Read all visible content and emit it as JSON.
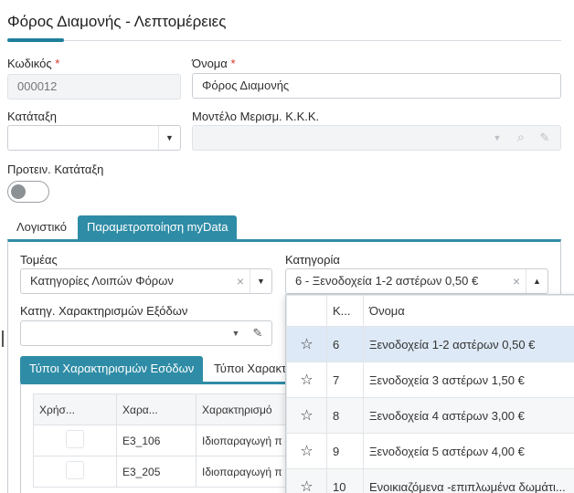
{
  "page": {
    "title": "Φόρος Διαμονής - Λεπτομέρειες"
  },
  "form": {
    "code_label": "Κωδικός",
    "code_value": "000012",
    "name_label": "Όνομα",
    "name_value": "Φόρος Διαμονής",
    "required_mark": "*",
    "category_label": "Κατάταξη",
    "category_value": "",
    "model_label": "Μοντέλο Μερισμ. Κ.Κ.Κ.",
    "model_value": "",
    "suggested_label": "Προτειν. Κατάταξη",
    "suggested_toggle": "off"
  },
  "tabs": [
    {
      "label": "Λογιστικό",
      "active": false
    },
    {
      "label": "Παραμετροποίηση myData",
      "active": true
    }
  ],
  "mydata": {
    "sector_label": "Τομέας",
    "sector_value": "Κατηγορίες Λοιπών Φόρων",
    "category_label": "Κατηγορία",
    "category_value": "6 - Ξενοδοχεία 1-2 αστέρων 0,50 €",
    "expense_label": "Κατηγ. Χαρακτηρισμών Εξόδων",
    "expense_value": ""
  },
  "subtabs": [
    {
      "label": "Τύποι Χαρακτηρισμών Εσόδων",
      "active": true
    },
    {
      "label": "Τύποι Χαρακτ",
      "active": false
    }
  ],
  "grid": {
    "columns": [
      "Χρήσ...",
      "Χαρα...",
      "Χαρακτηρισμό"
    ],
    "rows": [
      {
        "code": "Ε3_106",
        "desc": "Ιδιοπαραγωγή π"
      },
      {
        "code": "Ε3_205",
        "desc": "Ιδιοπαραγωγή π"
      }
    ]
  },
  "dropdown": {
    "columns": [
      "",
      "Κ...",
      "Όνομα"
    ],
    "items": [
      {
        "code": "6",
        "name": "Ξενοδοχεία 1-2 αστέρων 0,50 €",
        "selected": true
      },
      {
        "code": "7",
        "name": "Ξενοδοχεία 3 αστέρων 1,50 €",
        "selected": false
      },
      {
        "code": "8",
        "name": "Ξενοδοχεία 4 αστέρων 3,00 €",
        "selected": false
      },
      {
        "code": "9",
        "name": "Ξενοδοχεία 5 αστέρων 4,00 €",
        "selected": false
      },
      {
        "code": "10",
        "name": "Ενοικιαζόμενα -επιπλωμένα δωμάτι...",
        "selected": false
      }
    ]
  },
  "icons": {
    "star": "☆",
    "caret_down": "▼",
    "caret_up": "▲",
    "clear": "×",
    "pencil": "✎",
    "search": "⌕"
  },
  "colors": {
    "accent": "#2f8ca6",
    "title_accent": "#1e7f9b",
    "required": "#d93025",
    "selected_row": "#dde9f6"
  }
}
